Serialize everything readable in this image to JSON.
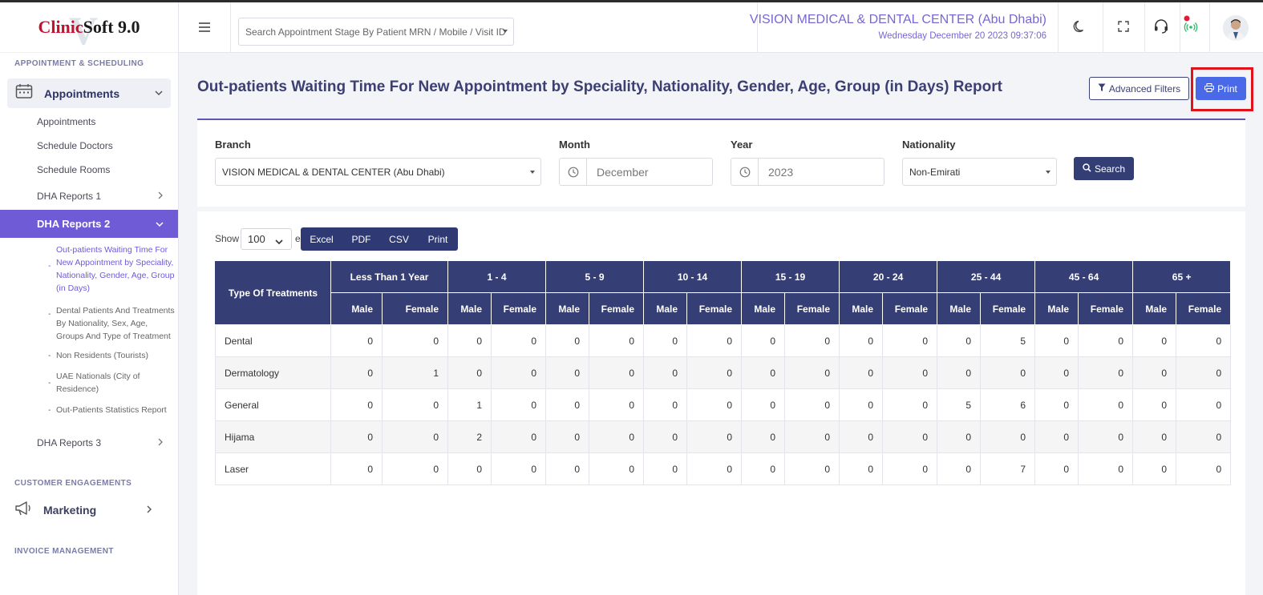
{
  "logo": {
    "part1": "Clinic",
    "part2": "Soft 9.0",
    "mark": "V"
  },
  "sidebar": {
    "section_appointment": "APPOINTMENT & SCHEDULING",
    "appointments_label": "Appointments",
    "sub_appointments": "Appointments",
    "sub_schedule_doctors": "Schedule Doctors",
    "sub_schedule_rooms": "Schedule Rooms",
    "sub_dha1": "DHA Reports 1",
    "sub_dha2": "DHA Reports 2",
    "child_1": "Out-patients Waiting Time For New Appointment by Speciality, Nationality, Gender, Age, Group (in Days)",
    "child_2": "Dental Patients And Treatments By Nationality, Sex, Age, Groups And Type of Treatment",
    "child_3": "Non Residents (Tourists)",
    "child_4": "UAE Nationals (City of Residence)",
    "child_5": "Out-Patients Statistics Report",
    "sub_dha3": "DHA Reports 3",
    "section_customer": "CUSTOMER ENGAGEMENTS",
    "marketing_label": "Marketing",
    "section_invoice": "INVOICE MANAGEMENT"
  },
  "header": {
    "search_placeholder": "Search Appointment Stage By Patient MRN / Mobile / Visit ID",
    "center_name": "VISION MEDICAL & DENTAL CENTER (Abu Dhabi)",
    "datetime": "Wednesday December 20 2023 09:37:06"
  },
  "page": {
    "title": "Out-patients Waiting Time For New Appointment by Speciality, Nationality, Gender, Age, Group (in Days) Report",
    "advanced_filters_label": "Advanced Filters",
    "print_label": "Print"
  },
  "filters": {
    "branch_label": "Branch",
    "branch_value": "VISION MEDICAL & DENTAL CENTER (Abu Dhabi)",
    "month_label": "Month",
    "month_value": "December",
    "year_label": "Year",
    "year_value": "2023",
    "nationality_label": "Nationality",
    "nationality_value": "Non-Emirati",
    "search_label": "Search"
  },
  "datatable": {
    "show_label": "Show",
    "show_value": "100",
    "entries_fragment": "e",
    "export_buttons": [
      "Excel",
      "PDF",
      "CSV",
      "Print"
    ]
  },
  "table": {
    "type_header": "Type Of Treatments",
    "age_groups": [
      "Less Than 1 Year",
      "1 - 4",
      "5 - 9",
      "10 - 14",
      "15 - 19",
      "20 - 24",
      "25 - 44",
      "45 - 64",
      "65 +"
    ],
    "gender_labels": [
      "Male",
      "Female"
    ],
    "rows": [
      {
        "name": "Dental",
        "values": [
          0,
          0,
          0,
          0,
          0,
          0,
          0,
          0,
          0,
          0,
          0,
          0,
          0,
          5,
          0,
          0,
          0,
          0
        ]
      },
      {
        "name": "Dermatology",
        "values": [
          0,
          1,
          0,
          0,
          0,
          0,
          0,
          0,
          0,
          0,
          0,
          0,
          0,
          0,
          0,
          0,
          0,
          0
        ]
      },
      {
        "name": "General",
        "values": [
          0,
          0,
          1,
          0,
          0,
          0,
          0,
          0,
          0,
          0,
          0,
          0,
          5,
          6,
          0,
          0,
          0,
          0
        ]
      },
      {
        "name": "Hijama",
        "values": [
          0,
          0,
          2,
          0,
          0,
          0,
          0,
          0,
          0,
          0,
          0,
          0,
          0,
          0,
          0,
          0,
          0,
          0
        ]
      },
      {
        "name": "Laser",
        "values": [
          0,
          0,
          0,
          0,
          0,
          0,
          0,
          0,
          0,
          0,
          0,
          0,
          0,
          7,
          0,
          0,
          0,
          0
        ]
      }
    ]
  }
}
